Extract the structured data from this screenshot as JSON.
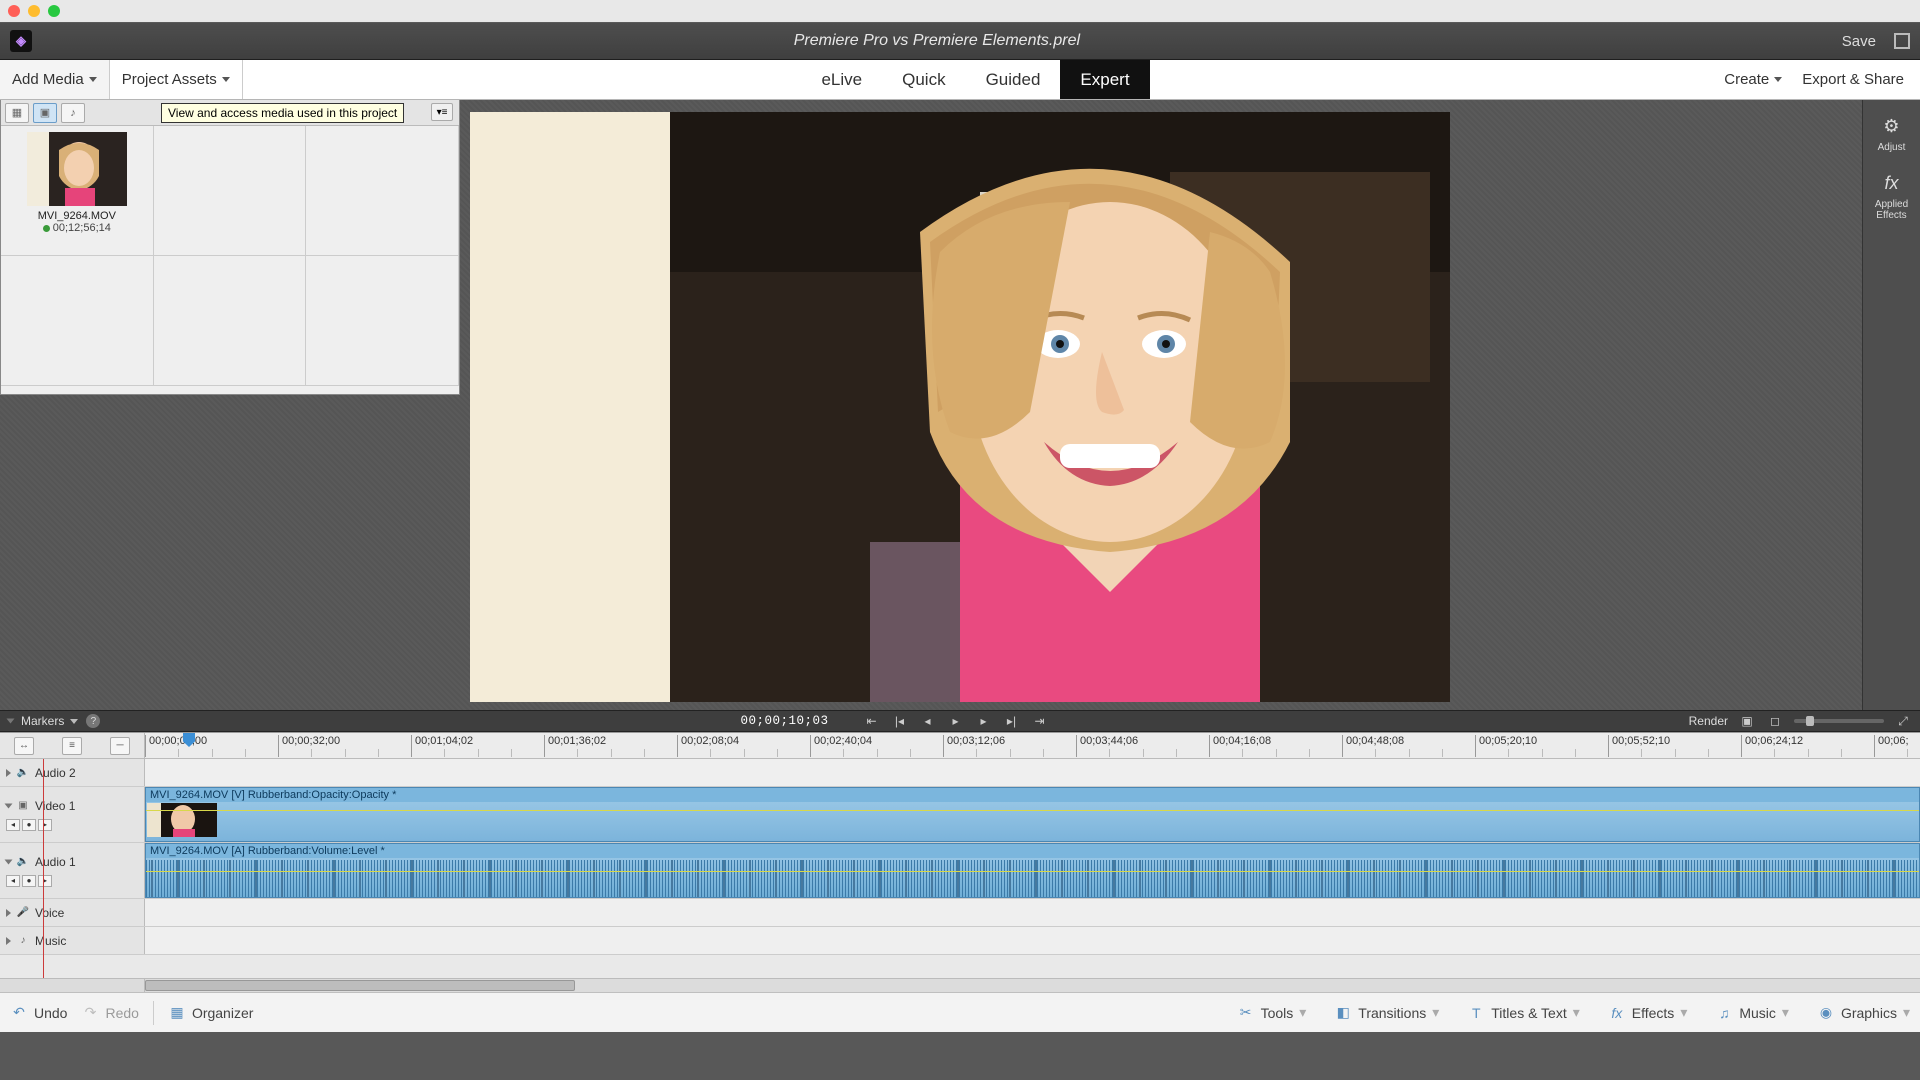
{
  "project_title": "Premiere Pro vs Premiere Elements.prel",
  "save_label": "Save",
  "menubar": {
    "add_media": "Add Media",
    "project_assets": "Project Assets",
    "create": "Create",
    "export": "Export & Share"
  },
  "modes": {
    "elive": "eLive",
    "quick": "Quick",
    "guided": "Guided",
    "expert": "Expert"
  },
  "tooltip": "View and access media used in this project",
  "asset": {
    "name": "MVI_9264.MOV",
    "duration": "00;12;56;14"
  },
  "right_rail": {
    "adjust": "Adjust",
    "effects": "Applied\nEffects"
  },
  "playback": {
    "markers": "Markers",
    "timecode": "00;00;10;03",
    "render": "Render"
  },
  "ruler": {
    "times": [
      "00;00;00;00",
      "00;00;32;00",
      "00;01;04;02",
      "00;01;36;02",
      "00;02;08;04",
      "00;02;40;04",
      "00;03;12;06",
      "00;03;44;06",
      "00;04;16;08",
      "00;04;48;08",
      "00;05;20;10",
      "00;05;52;10",
      "00;06;24;12",
      "00;06;"
    ]
  },
  "tracks": {
    "audio2": "Audio 2",
    "video1": "Video 1",
    "audio1": "Audio 1",
    "voice": "Voice",
    "music": "Music"
  },
  "clips": {
    "video_label": "MVI_9264.MOV [V] Rubberband:Opacity:Opacity *",
    "audio_label": "MVI_9264.MOV [A] Rubberband:Volume:Level *"
  },
  "footer": {
    "undo": "Undo",
    "redo": "Redo",
    "organizer": "Organizer",
    "tools": "Tools",
    "transitions": "Transitions",
    "titles": "Titles & Text",
    "effects": "Effects",
    "music": "Music",
    "graphics": "Graphics"
  }
}
